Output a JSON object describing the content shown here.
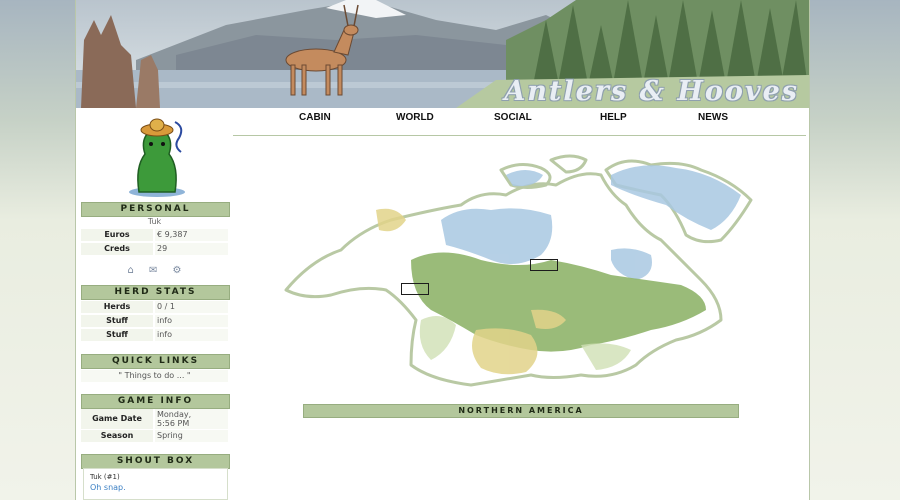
{
  "banner": {
    "title": "Antlers & Hooves"
  },
  "nav": {
    "items": [
      "CABIN",
      "WORLD",
      "SOCIAL",
      "HELP",
      "NEWS"
    ]
  },
  "sidebar": {
    "personal": {
      "heading": "PERSONAL",
      "name": "Tuk",
      "euros_label": "Euros",
      "euros_value": "€ 9,387",
      "creds_label": "Creds",
      "creds_value": "29",
      "icons": [
        "home-icon",
        "mail-icon",
        "settings-icon"
      ]
    },
    "herd_stats": {
      "heading": "HERD STATS",
      "rows": [
        {
          "label": "Herds",
          "value": "0 / 1"
        },
        {
          "label": "Stuff",
          "value": "info"
        },
        {
          "label": "Stuff",
          "value": "info"
        }
      ]
    },
    "quick_links": {
      "heading": "QUICK LINKS",
      "text": "\" Things to do ... \""
    },
    "game_info": {
      "heading": "GAME INFO",
      "date_label": "Game Date",
      "date_value_line1": "Monday,",
      "date_value_line2": "5:56 PM",
      "season_label": "Season",
      "season_value": "Spring"
    },
    "shout_box": {
      "heading": "SHOUT BOX",
      "user": "Tuk (#1)",
      "message": "Oh snap."
    }
  },
  "map": {
    "caption": "NORTHERN AMERICA",
    "colors": {
      "water": "#a9c8e2",
      "forest": "#8fb46a",
      "plains": "#e2d38a",
      "outline": "#b9c9a4"
    }
  }
}
